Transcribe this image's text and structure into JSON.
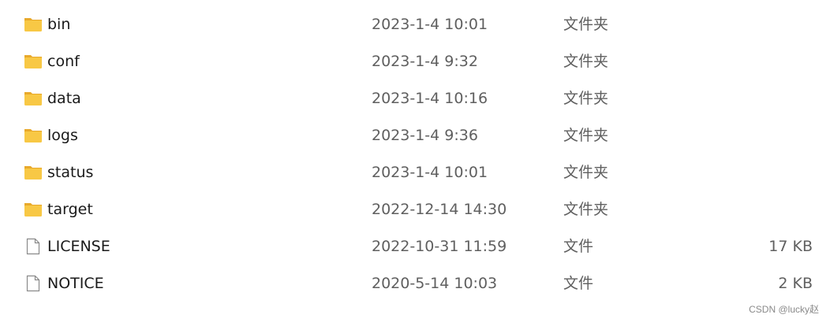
{
  "files": [
    {
      "name": "bin",
      "date": "2023-1-4 10:01",
      "type": "文件夹",
      "size": "",
      "icon": "folder-icon"
    },
    {
      "name": "conf",
      "date": "2023-1-4 9:32",
      "type": "文件夹",
      "size": "",
      "icon": "folder-icon"
    },
    {
      "name": "data",
      "date": "2023-1-4 10:16",
      "type": "文件夹",
      "size": "",
      "icon": "folder-icon"
    },
    {
      "name": "logs",
      "date": "2023-1-4 9:36",
      "type": "文件夹",
      "size": "",
      "icon": "folder-icon"
    },
    {
      "name": "status",
      "date": "2023-1-4 10:01",
      "type": "文件夹",
      "size": "",
      "icon": "folder-icon"
    },
    {
      "name": "target",
      "date": "2022-12-14 14:30",
      "type": "文件夹",
      "size": "",
      "icon": "folder-icon"
    },
    {
      "name": "LICENSE",
      "date": "2022-10-31 11:59",
      "type": "文件",
      "size": "17 KB",
      "icon": "file-icon"
    },
    {
      "name": "NOTICE",
      "date": "2020-5-14 10:03",
      "type": "文件",
      "size": "2 KB",
      "icon": "file-icon"
    }
  ],
  "watermark": "CSDN @lucky赵",
  "colors": {
    "folder_body": "#F8C845",
    "folder_tab": "#E8A92B",
    "file_outline": "#8a8a8a"
  }
}
